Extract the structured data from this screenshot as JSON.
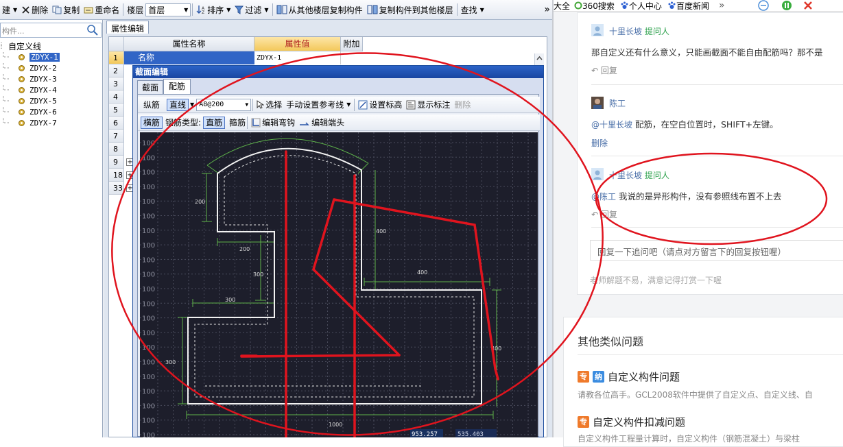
{
  "toolbar": {
    "new": "建",
    "delete": "删除",
    "copy": "复制",
    "rename": "重命名",
    "floor_label": "楼层",
    "floor_value": "首层",
    "sort": "排序",
    "filter": "过滤",
    "copy_from_floor": "从其他楼层复制构件",
    "copy_to_floor": "复制构件到其他楼层",
    "find": "查找",
    "overflow": "»"
  },
  "tree": {
    "search_placeholder": "构件...",
    "root": "自定义线",
    "items": [
      "ZDYX-1",
      "ZDYX-2",
      "ZDYX-3",
      "ZDYX-4",
      "ZDYX-5",
      "ZDYX-6",
      "ZDYX-7"
    ]
  },
  "attr": {
    "tab": "属性编辑",
    "col_name": "属性名称",
    "col_value": "属性值",
    "col_extra": "附加",
    "rows": [
      "1",
      "2",
      "3",
      "4",
      "5",
      "6",
      "7",
      "8",
      "9",
      "18",
      "33"
    ],
    "row1_name": "名称",
    "row1_value": "ZDYX-1"
  },
  "dialog": {
    "title": "截面编辑",
    "tab_section": "截面",
    "tab_rebar": "配筋",
    "longitudinal": "纵筋",
    "straight": "直线",
    "rebar_value": "A8@200",
    "select": "选择",
    "manual_ref": "手动设置参考线",
    "set_height": "设置标高",
    "show_dim": "显示标注",
    "delete": "删除",
    "transverse": "横筋",
    "rebar_type": "钢筋类型:",
    "straight2": "直筋",
    "stirrup": "箍筋",
    "edit_hook": "编辑弯钩",
    "edit_end": "编辑端头",
    "grid_label": "100",
    "dims": {
      "d200a": "200",
      "d200b": "200",
      "d300a": "300",
      "d300b": "300",
      "d300c": "300",
      "d400a": "400",
      "d400b": "400",
      "d400c": "400",
      "d1000": "1000"
    },
    "coord_x": "953.257",
    "coord_y": "535.403"
  },
  "browser": {
    "bookmarks": [
      "大全",
      "360搜索",
      "个人中心",
      "百度新闻"
    ],
    "overflow": "»"
  },
  "qa": {
    "c1_nick": "十里长坡",
    "c1_tag": "提问人",
    "c1_text": "那自定义还有什么意义，只能画截面不能自由配筋吗？那不是",
    "c1_reply": "回复",
    "c2_nick": "陈工",
    "c2_text_prefix": "@十里长坡",
    "c2_text": "配筋，在空白位置时，SHIFT+左键。",
    "c2_delete": "删除",
    "c3_nick": "十里长坡",
    "c3_tag": "提问人",
    "c3_text_prefix": "@陈工",
    "c3_text": "我说的是异形构件，没有参照线布置不上去",
    "c3_reply": "回复",
    "reply_placeholder": "回复一下追问吧（请点对方留言下的回复按钮喔）",
    "thanks": "老师解题不易，满意记得打赏一下喔"
  },
  "similar": {
    "heading": "其他类似问题",
    "q1_badge1": "专",
    "q1_badge2": "纳",
    "q1_title": "自定义构件问题",
    "q1_snippet": "请教各位高手。GCL2008软件中提供了自定义点、自定义线、自",
    "q2_badge1": "专",
    "q2_title": "自定义构件扣减问题",
    "q2_snippet": "自定义构件工程量计算时，自定义构件（钢筋混凝土）与梁柱"
  },
  "colors": {
    "annotation_red": "#e0141e",
    "canvas_bg": "#1d1e2b",
    "tag_green": "#2aa04a",
    "nick_blue": "#4a6fa8"
  }
}
